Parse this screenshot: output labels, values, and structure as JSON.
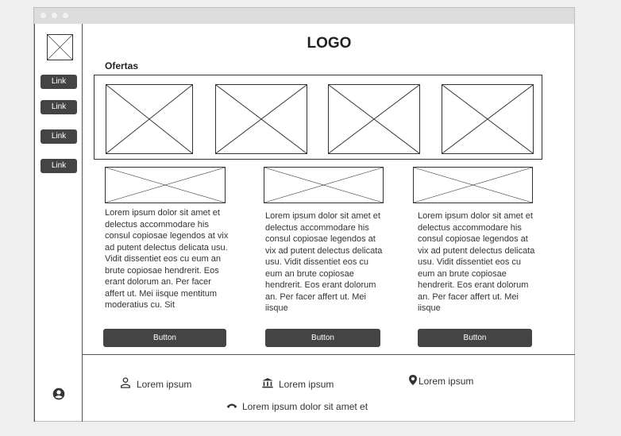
{
  "logo": "LOGO",
  "sidebar": {
    "links": [
      "Link",
      "Link",
      "Link",
      "Link"
    ]
  },
  "offers_label": "Ofertas",
  "columns": [
    {
      "text": "Lorem ipsum dolor sit amet et delectus accommodare his consul copiosae legendos at vix ad putent delectus delicata usu. Vidit dissentiet eos cu eum an brute copiosae hendrerit. Eos erant dolorum an. Per facer affert ut. Mei iisque mentitum moderatius cu. Sit",
      "button": "Button"
    },
    {
      "text": "Lorem ipsum dolor sit amet et delectus accommodare his consul copiosae legendos at vix ad putent delectus delicata usu. Vidit dissentiet eos cu eum an brute copiosae hendrerit. Eos erant dolorum an. Per facer affert ut. Mei iisque",
      "button": "Button"
    },
    {
      "text": "Lorem ipsum dolor sit amet et delectus accommodare his consul copiosae legendos at vix ad putent delectus delicata usu. Vidit dissentiet eos cu eum an brute copiosae hendrerit. Eos erant dolorum an. Per facer affert ut. Mei iisque",
      "button": "Button"
    }
  ],
  "footer": {
    "items": [
      "Lorem ipsum",
      "Lorem ipsum",
      "Lorem ipsum"
    ],
    "bottom": "Lorem ipsum dolor sit amet et"
  },
  "icons": {
    "user": "user-icon",
    "bank": "bank-icon",
    "pin": "map-pin-icon",
    "phone": "phone-icon",
    "account": "account-circle-icon"
  }
}
